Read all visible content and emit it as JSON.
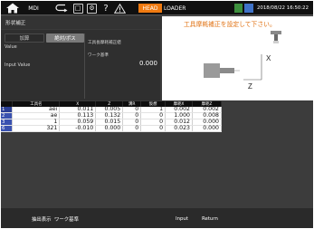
{
  "topbar": {
    "home_icon": "home-icon",
    "mode": "MDI",
    "undo_icon": "undo-icon",
    "panel_icon": "panel-icon",
    "settings_icon": "settings-icon",
    "help": "?",
    "warn_icon": "warning-icon",
    "head": "HEAD",
    "loader": "LOADER",
    "datetime": "2018/08/22 16:50:22",
    "accent_orange": "#f07a10",
    "status_green": "#3d8f3d",
    "status_blue": "#3f72c8"
  },
  "title": "形状補正",
  "left_panel": {
    "tab_add": "加算",
    "tab_absolute": "絶対/ポス",
    "value_label": "Value",
    "input_value_label": "Input Value",
    "tool_length_label": "工具長摩耗補正値",
    "work_origin_label": "ワーク基準",
    "value": "0.000"
  },
  "right_panel": {
    "title": "工具摩耗補正を設定して下さい。",
    "x_label": "X",
    "z_label": "Z"
  },
  "table": {
    "columns": [
      "",
      "工具名",
      "X",
      "Z",
      "溝R",
      "仮想",
      "摩耗X",
      "摩耗Z"
    ],
    "rows": [
      [
        "1",
        "aei",
        "0.011",
        "0.005",
        "0",
        "1",
        "0.002",
        "0.002"
      ],
      [
        "2",
        "ae",
        "0.113",
        "0.132",
        "0",
        "0",
        "1.000",
        "0.008"
      ],
      [
        "3",
        "1",
        "0.059",
        "0.015",
        "0",
        "0",
        "0.012",
        "0.000"
      ],
      [
        "6",
        "321",
        "-0.010",
        "0.000",
        "0",
        "0",
        "0.023",
        "0.000"
      ]
    ]
  },
  "bottom_bar": {
    "extract": "抽出表示",
    "work_origin": "ワーク基準",
    "input": "Input",
    "return": "Return"
  }
}
